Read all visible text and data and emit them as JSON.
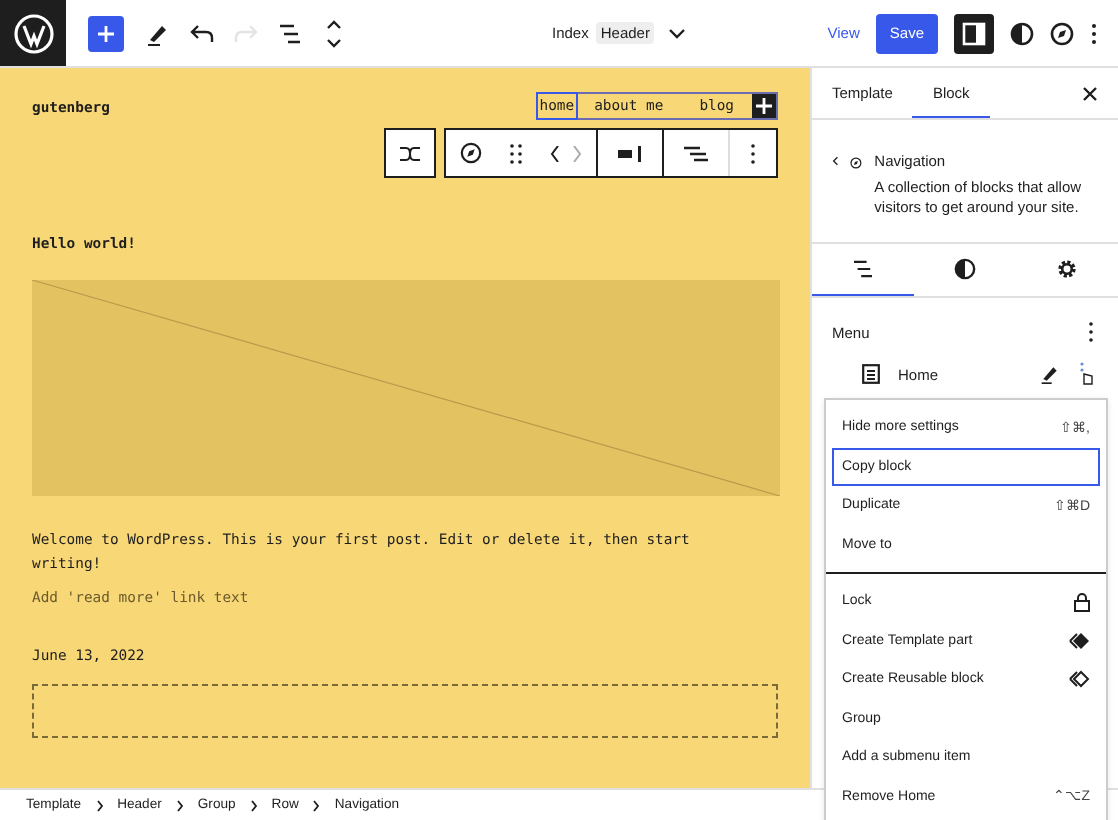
{
  "topbar": {
    "tools": [
      {
        "kind": "add",
        "disabled": false
      },
      {
        "kind": "pen",
        "disabled": false
      },
      {
        "kind": "undo",
        "disabled": false
      },
      {
        "kind": "redo",
        "disabled": true
      },
      {
        "kind": "list",
        "disabled": false
      },
      {
        "kind": "updown",
        "disabled": false
      }
    ],
    "document": {
      "title": "Index",
      "badge": "Header"
    },
    "view": "View",
    "save": "Save",
    "sidebar_toggle_pressed": true
  },
  "canvas": {
    "site_title": "gutenberg",
    "nav": [
      {
        "label": "home",
        "selected": true
      },
      {
        "label": "about me",
        "selected": false
      },
      {
        "label": "blog",
        "selected": false
      }
    ],
    "heading": "Hello world!",
    "paragraph": "Welcome to WordPress. This is your first post. Edit or delete it, then start writing!",
    "read_more": "Add 'read more' link text",
    "date": "June 13, 2022"
  },
  "breadcrumbs": [
    "Template",
    "Header",
    "Group",
    "Row",
    "Navigation"
  ],
  "sidebar": {
    "tabs": [
      {
        "label": "Template",
        "selected": false
      },
      {
        "label": "Block",
        "selected": true
      }
    ],
    "block": {
      "name": "Navigation",
      "description": "A collection of blocks that allow visitors to get around your site."
    },
    "setting_tabs": [
      {
        "kind": "list",
        "selected": true
      },
      {
        "kind": "styles",
        "selected": false
      },
      {
        "kind": "settings",
        "selected": false
      }
    ],
    "menu_title": "Menu",
    "item": "Home"
  },
  "popover": {
    "groups": [
      {
        "items": [
          {
            "label": "Hide more settings",
            "shortcut": "⇧⌘,",
            "kind": "plain",
            "selected": false
          },
          {
            "label": "Copy block",
            "kind": "plain",
            "selected": true
          },
          {
            "label": "Duplicate",
            "shortcut": "⇧⌘D",
            "kind": "plain",
            "selected": false
          },
          {
            "label": "Move to",
            "kind": "plain",
            "selected": false
          }
        ]
      },
      {
        "items": [
          {
            "label": "Lock",
            "kind": "lock",
            "selected": false
          },
          {
            "label": "Create Template part",
            "kind": "template-part",
            "selected": false
          },
          {
            "label": "Create Reusable block",
            "kind": "reusable",
            "selected": false
          },
          {
            "label": "Group",
            "kind": "plain",
            "selected": false
          },
          {
            "label": "Add a submenu item",
            "kind": "plain",
            "selected": false
          },
          {
            "label": "Remove Home",
            "shortcut": "⌃⌥Z",
            "kind": "plain",
            "selected": false
          }
        ]
      }
    ]
  }
}
